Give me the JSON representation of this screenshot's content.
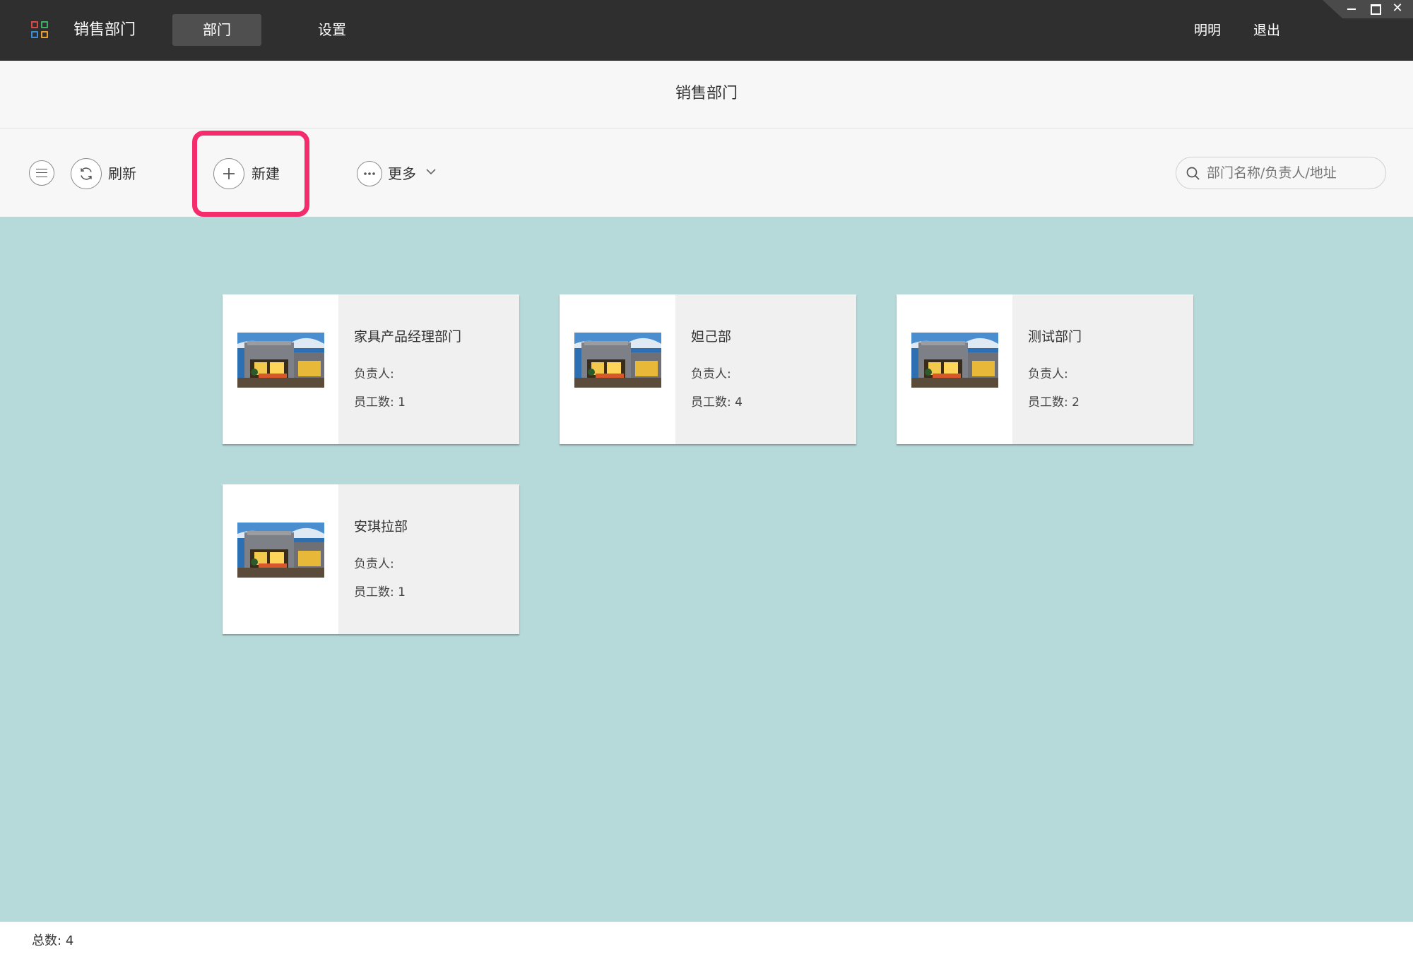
{
  "header": {
    "app_title": "销售部门",
    "tabs": [
      {
        "label": "部门",
        "active": true
      },
      {
        "label": "设置",
        "active": false
      }
    ],
    "user_name": "明明",
    "logout_label": "退出"
  },
  "page": {
    "title": "销售部门"
  },
  "toolbar": {
    "refresh_label": "刷新",
    "new_label": "新建",
    "more_label": "更多",
    "highlight_color": "#f42c6b"
  },
  "search": {
    "placeholder": "部门名称/负责人/地址",
    "value": ""
  },
  "departments": [
    {
      "name": "家具产品经理部门",
      "manager_label": "负责人:",
      "manager": "",
      "count_label": "员工数:",
      "count": "1"
    },
    {
      "name": "妲己部",
      "manager_label": "负责人:",
      "manager": "",
      "count_label": "员工数:",
      "count": "4"
    },
    {
      "name": "测试部门",
      "manager_label": "负责人:",
      "manager": "",
      "count_label": "员工数:",
      "count": "2"
    },
    {
      "name": "安琪拉部",
      "manager_label": "负责人:",
      "manager": "",
      "count_label": "员工数:",
      "count": "1"
    }
  ],
  "footer": {
    "total_label": "总数:",
    "total": "4"
  },
  "colors": {
    "topbar": "#2f2f2f",
    "content_bg": "#b6d9d9",
    "card_bg": "#f0f0f0"
  }
}
